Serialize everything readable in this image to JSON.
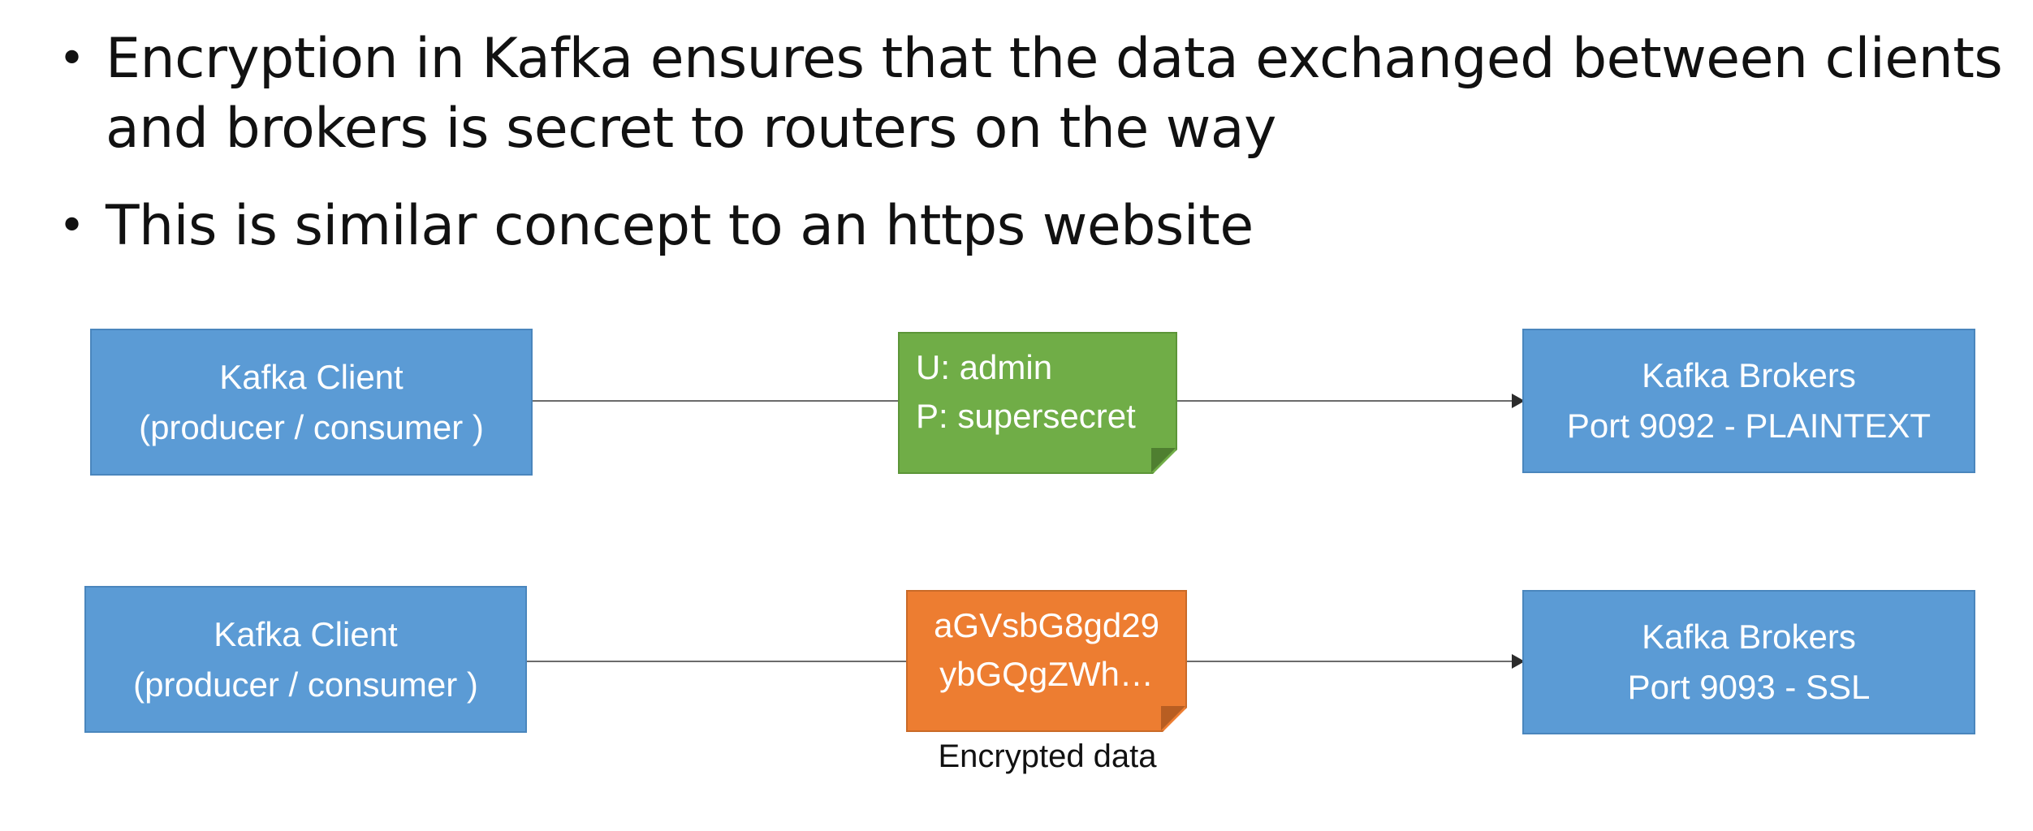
{
  "bullets": [
    {
      "marker": "•",
      "lines": [
        "Encryption in Kafka ensures that the data exchanged between clients",
        "and brokers is secret to routers on the way"
      ]
    },
    {
      "marker": "•",
      "lines": [
        "This is similar concept to an https website"
      ]
    }
  ],
  "diagram": {
    "plaintext_row": {
      "client": {
        "line1": "Kafka Client",
        "line2": "(producer / consumer )"
      },
      "message": {
        "line1": "U: admin",
        "line2": "P: supersecret"
      },
      "broker": {
        "line1": "Kafka Brokers",
        "line2": "Port 9092 - PLAINTEXT"
      }
    },
    "ssl_row": {
      "client": {
        "line1": "Kafka Client",
        "line2": "(producer / consumer )"
      },
      "message": {
        "line1": "aGVsbG8gd29",
        "line2": "ybGQgZWh…"
      },
      "message_caption": "Encrypted data",
      "broker": {
        "line1": "Kafka Brokers",
        "line2": "Port 9093 - SSL"
      }
    },
    "colors": {
      "box_blue": "#5b9bd5",
      "note_green": "#70ad47",
      "note_orange": "#ed7d31"
    }
  }
}
